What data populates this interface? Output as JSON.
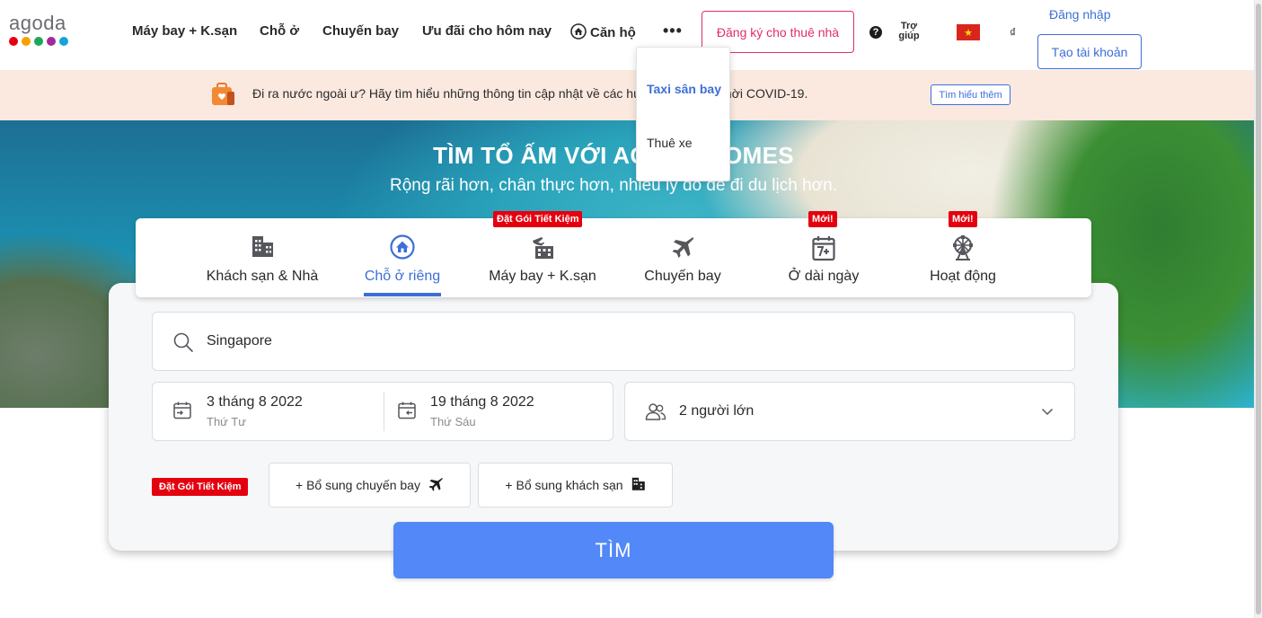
{
  "brand": {
    "logo_text": "agoda",
    "dot_colors": [
      "#e4000f",
      "#f5a000",
      "#1ba85a",
      "#a12a9a",
      "#15a3d8"
    ]
  },
  "nav": {
    "flight_hotel": "Máy bay + K.sạn",
    "stays": "Chỗ ở",
    "flights": "Chuyến bay",
    "deals": "Ưu đãi cho hôm nay",
    "apartments": "Căn hộ",
    "more": "•••",
    "register_property": "Đăng ký cho thuê nhà",
    "help_line1": "Trợ",
    "help_line2": "giúp",
    "currency": "₫",
    "login": "Đăng nhập",
    "create_account": "Tạo tài khoản"
  },
  "more_menu": {
    "items": [
      {
        "label": "Taxi sân bay",
        "active": true
      },
      {
        "label": "Thuê xe",
        "active": false
      }
    ]
  },
  "notice": {
    "text": "Đi ra nước ngoài ư? Hãy tìm hiểu những thông tin cập nhật về các hướng dẫn đi lại thời COVID-19.",
    "button": "Tìm hiểu thêm"
  },
  "hero": {
    "title": "TÌM TỔ ẤM VỚI AGODA HOMES",
    "subtitle": "Rộng rãi hơn, chân thực hơn, nhiều lý do để đi du lịch hơn."
  },
  "tabs": [
    {
      "label": "Khách sạn & Nhà",
      "badge": "",
      "icon": "building-icon",
      "active": false
    },
    {
      "label": "Chỗ ở riêng",
      "badge": "",
      "icon": "home-icon",
      "active": true
    },
    {
      "label": "Máy bay + K.sạn",
      "badge": "Đặt Gói Tiết Kiệm",
      "icon": "flight-hotel-icon",
      "active": false
    },
    {
      "label": "Chuyến bay",
      "badge": "",
      "icon": "plane-icon",
      "active": false
    },
    {
      "label": "Ở dài ngày",
      "badge": "Mới!",
      "icon": "calendar-7-icon",
      "active": false
    },
    {
      "label": "Hoạt động",
      "badge": "Mới!",
      "icon": "ferris-wheel-icon",
      "active": false
    }
  ],
  "search": {
    "destination": "Singapore",
    "checkin_date": "3 tháng 8 2022",
    "checkin_day": "Thứ Tư",
    "checkout_date": "19 tháng 8 2022",
    "checkout_day": "Thứ Sáu",
    "guests": "2 người lớn",
    "promo_badge": "Đặt Gói Tiết Kiệm",
    "add_flight": "+ Bổ sung chuyến bay",
    "add_hotel": "+ Bổ sung khách sạn",
    "submit": "TÌM"
  },
  "colors": {
    "accent": "#3d6ed9",
    "search_button": "#5288f7",
    "register": "#e12d6a",
    "badge": "#e4000f",
    "notice_bg": "#fbe9df"
  }
}
